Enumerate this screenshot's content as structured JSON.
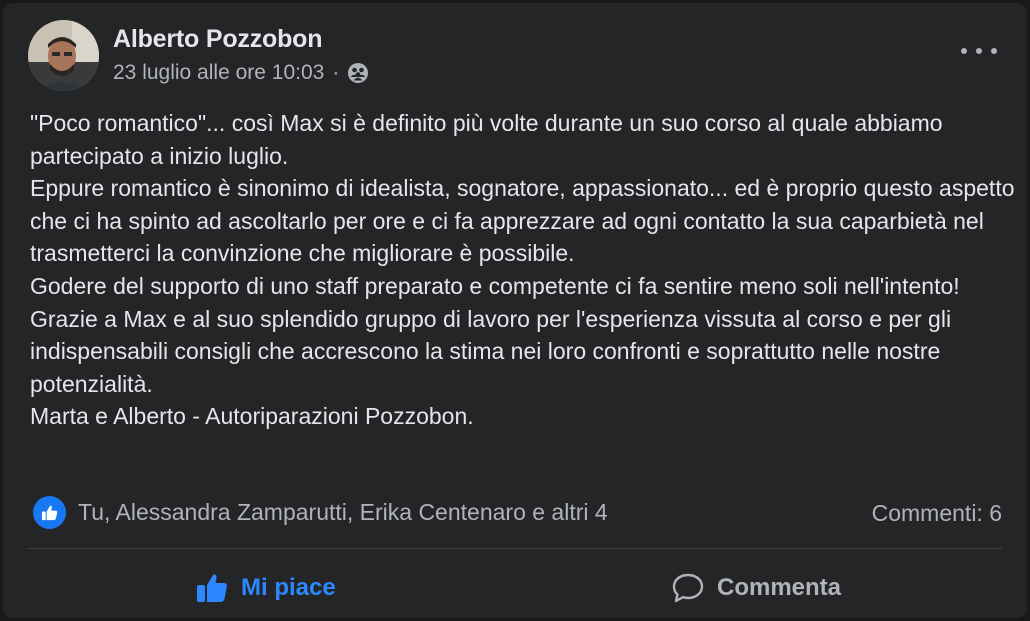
{
  "post": {
    "author": "Alberto Pozzobon",
    "date": "23 luglio alle ore 10:03",
    "separator": "·",
    "more_icon": "more-horizontal-icon",
    "privacy_icon": "friends-icon",
    "body": [
      "\"Poco romantico\"... così Max si è definito più volte durante un suo corso al quale abbiamo partecipato a inizio luglio.",
      "Eppure romantico è sinonimo di idealista, sognatore, appassionato... ed è proprio questo aspetto che ci ha spinto ad ascoltarlo per ore e ci fa apprezzare ad ogni contatto la sua caparbietà nel trasmetterci la convinzione che migliorare è possibile.",
      "Godere del supporto di uno staff preparato e competente ci fa sentire meno soli nell'intento!",
      "Grazie a Max e al suo splendido gruppo di lavoro per l'esperienza vissuta al corso e per gli indispensabili consigli che accrescono la stima nei loro confronti e soprattutto nelle nostre potenzialità.",
      "Marta e Alberto - Autoriparazioni Pozzobon."
    ]
  },
  "reactions": {
    "summary": "Tu, Alessandra Zamparutti, Erika Centenaro e altri 4",
    "comments": "Commenti: 6"
  },
  "actions": {
    "like_label": "Mi piace",
    "comment_label": "Commenta"
  },
  "colors": {
    "background": "#242526",
    "text": "#e4e6eb",
    "secondary": "#b0b3b8",
    "accent": "#2d88ff"
  }
}
